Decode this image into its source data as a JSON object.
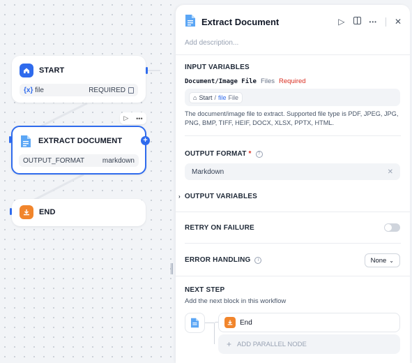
{
  "canvas": {
    "nodes": {
      "start": {
        "title": "START",
        "var_prefix": "{x}",
        "var_name": "file",
        "var_flag": "REQUIRED"
      },
      "extract": {
        "title": "EXTRACT DOCUMENT",
        "param_key": "OUTPUT_FORMAT",
        "param_value": "markdown"
      },
      "end": {
        "title": "END"
      }
    },
    "add_symbol": "+"
  },
  "panel": {
    "title": "Extract Document",
    "description_placeholder": "Add description...",
    "input_variables": {
      "heading": "INPUT VARIABLES",
      "name": "Document/Image File",
      "type": "Files",
      "required": "Required",
      "chip_source": "Start",
      "chip_sep": "/",
      "chip_var": "file",
      "chip_type": "File",
      "help": "The document/image file to extract. Supported file type is PDF, JPEG, JPG, PNG, BMP, TIFF, HEIF, DOCX, XLSX, PPTX, HTML."
    },
    "output_format": {
      "heading": "OUTPUT FORMAT",
      "required_mark": "*",
      "help_mark": "?",
      "value": "Markdown"
    },
    "output_variables": {
      "heading": "OUTPUT VARIABLES"
    },
    "retry": {
      "heading": "RETRY ON FAILURE",
      "enabled": false
    },
    "error_handling": {
      "heading": "ERROR HANDLING",
      "help_mark": "i",
      "value": "None"
    },
    "next_step": {
      "heading": "NEXT STEP",
      "subtitle": "Add the next block in this workflow",
      "next_node": "End",
      "add_parallel": "ADD PARALLEL NODE",
      "add_symbol": "+"
    }
  },
  "colors": {
    "accent": "#2f6bed",
    "end_node": "#f1852c",
    "required": "#d92d20"
  },
  "icons": {
    "start": "home-icon",
    "extract": "document-icon",
    "end": "end-download-icon",
    "run": "play-icon",
    "layout": "split-view-icon",
    "more": "more-dots-icon",
    "close": "close-icon"
  }
}
